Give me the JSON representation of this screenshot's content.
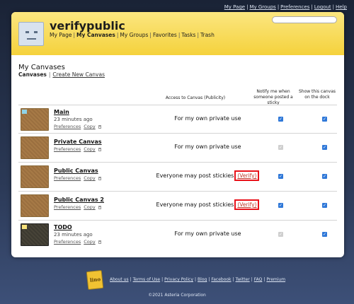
{
  "top_links": [
    "My Page",
    "My Groups",
    "Preferences",
    "Logout",
    "Help"
  ],
  "header": {
    "username": "verifypublic",
    "nav": [
      "My Page",
      "My Canvases",
      "My Groups",
      "Favorites",
      "Tasks",
      "Trash"
    ],
    "active_nav": "My Canvases"
  },
  "page": {
    "title": "My Canvases",
    "subnav_current": "Canvases",
    "subnav_link": "Create New Canvas"
  },
  "columns": {
    "access": "Access to Canvas (Publicity)",
    "notify": "Notify me when someone posted a sticky",
    "show": "Show this canvas on the dock"
  },
  "rows": [
    {
      "name": "Main",
      "time": "23 minutes ago",
      "actions": [
        "Preferences",
        "Copy"
      ],
      "access": "For my own private use",
      "verify": "",
      "notify": true,
      "notify_disabled": false,
      "show": true,
      "theme": "cork"
    },
    {
      "name": "Private Canvas",
      "time": "",
      "actions": [
        "Preferences",
        "Copy"
      ],
      "access": "For my own private use",
      "verify": "",
      "notify": true,
      "notify_disabled": true,
      "show": true,
      "theme": "cork"
    },
    {
      "name": "Public Canvas",
      "time": "",
      "actions": [
        "Preferences",
        "Copy"
      ],
      "access": "Everyone may post stickies",
      "verify": "(Verify)",
      "notify": true,
      "notify_disabled": false,
      "show": true,
      "theme": "cork"
    },
    {
      "name": "Public Canvas 2",
      "time": "",
      "actions": [
        "Preferences",
        "Copy"
      ],
      "access": "Everyone may post stickies",
      "verify": "(Verify)",
      "notify": true,
      "notify_disabled": false,
      "show": true,
      "theme": "cork"
    },
    {
      "name": "TODO",
      "time": "23 minutes ago",
      "actions": [
        "Preferences",
        "Copy"
      ],
      "access": "For my own private use",
      "verify": "",
      "notify": true,
      "notify_disabled": true,
      "show": true,
      "theme": "dark"
    }
  ],
  "footer": {
    "logo_text": "lino",
    "links": [
      "About us",
      "Terms of Use",
      "Privacy Policy",
      "Blog",
      "Facebook",
      "Twitter",
      "FAQ",
      "Premium"
    ],
    "copyright": "©2021 Asteria Corporation"
  },
  "colors": {
    "accent_yellow": "#f5d23c",
    "verify_border": "#e8121a",
    "checkbox_blue": "#2f78d8"
  }
}
